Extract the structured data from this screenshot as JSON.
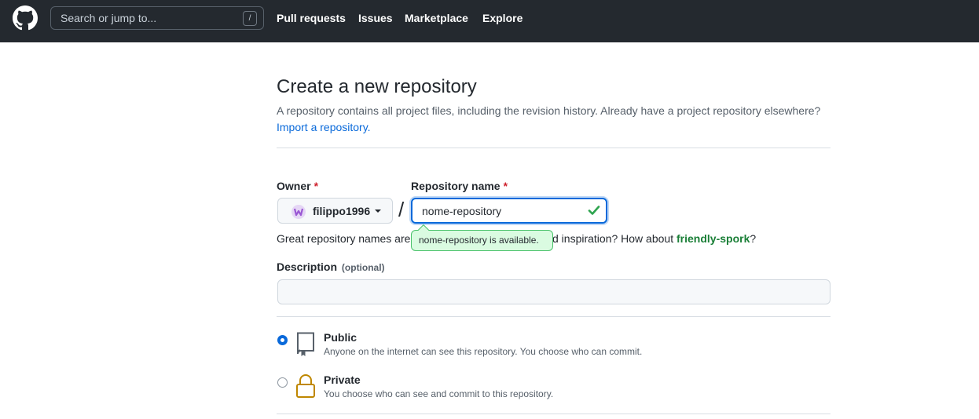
{
  "header": {
    "search_placeholder": "Search or jump to...",
    "search_shortcut": "/",
    "nav": [
      "Pull requests",
      "Issues",
      "Marketplace",
      "Explore"
    ]
  },
  "page": {
    "title": "Create a new repository",
    "subtitle_text": "A repository contains all project files, including the revision history. Already have a project repository elsewhere?",
    "import_link": "Import a repository.",
    "owner_label": "Owner",
    "owner_value": "filippo1996",
    "repo_label": "Repository name",
    "repo_value": "nome-repository",
    "required_mark": "*",
    "separator": "/",
    "availability_tooltip": "nome-repository is available.",
    "hint_prefix": "Great repository names are",
    "hint_suffix": "d inspiration? How about",
    "suggestion": "friendly-spork",
    "hint_end": "?",
    "description_label": "Description",
    "description_optional": "(optional)",
    "description_value": "",
    "visibility": [
      {
        "title": "Public",
        "note": "Anyone on the internet can see this repository. You choose who can commit.",
        "checked": true,
        "icon": "repo-icon"
      },
      {
        "title": "Private",
        "note": "You choose who can see and commit to this repository.",
        "checked": false,
        "icon": "lock-icon"
      }
    ]
  },
  "colors": {
    "header_bg": "#24292f",
    "link": "#0969da",
    "success": "#1a7f37",
    "required": "#cf222e",
    "lock": "#bf8700"
  }
}
